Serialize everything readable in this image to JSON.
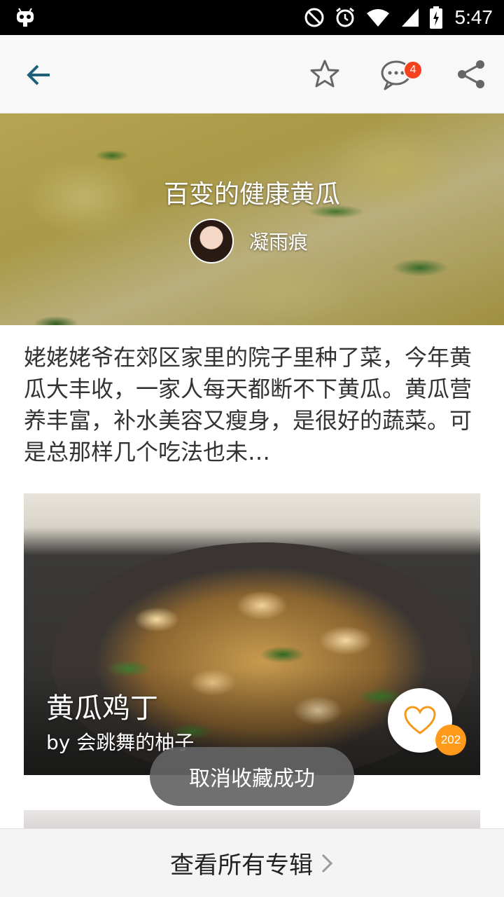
{
  "status_bar": {
    "time": "5:47"
  },
  "toolbar": {
    "comment_count": "4"
  },
  "hero": {
    "title": "百变的健康黄瓜",
    "author": "凝雨痕"
  },
  "description": "姥姥姥爷在郊区家里的院子里种了菜，今年黄瓜大丰收，一家人每天都断不下黄瓜。黄瓜营养丰富，补水美容又瘦身，是很好的蔬菜。可是总那样几个吃法也未…",
  "recipe_card": {
    "title": "黄瓜鸡丁",
    "author": "by 会跳舞的柚子",
    "like_count": "202"
  },
  "toast": {
    "message": "取消收藏成功"
  },
  "bottom_bar": {
    "label": "查看所有专辑"
  },
  "colors": {
    "accent": "#1f5f7a",
    "badge": "#f4411e",
    "like_orange": "#ff9a1a"
  }
}
